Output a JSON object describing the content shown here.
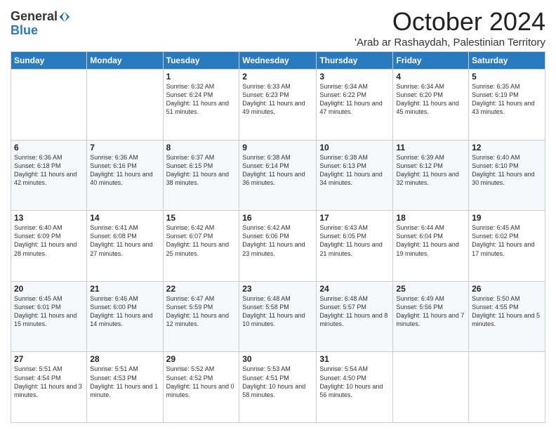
{
  "logo": {
    "general": "General",
    "blue": "Blue"
  },
  "header": {
    "month": "October 2024",
    "location": "'Arab ar Rashaydah, Palestinian Territory"
  },
  "days_of_week": [
    "Sunday",
    "Monday",
    "Tuesday",
    "Wednesday",
    "Thursday",
    "Friday",
    "Saturday"
  ],
  "weeks": [
    [
      {
        "day": "",
        "info": ""
      },
      {
        "day": "",
        "info": ""
      },
      {
        "day": "1",
        "info": "Sunrise: 6:32 AM\nSunset: 6:24 PM\nDaylight: 11 hours and 51 minutes."
      },
      {
        "day": "2",
        "info": "Sunrise: 6:33 AM\nSunset: 6:23 PM\nDaylight: 11 hours and 49 minutes."
      },
      {
        "day": "3",
        "info": "Sunrise: 6:34 AM\nSunset: 6:22 PM\nDaylight: 11 hours and 47 minutes."
      },
      {
        "day": "4",
        "info": "Sunrise: 6:34 AM\nSunset: 6:20 PM\nDaylight: 11 hours and 45 minutes."
      },
      {
        "day": "5",
        "info": "Sunrise: 6:35 AM\nSunset: 6:19 PM\nDaylight: 11 hours and 43 minutes."
      }
    ],
    [
      {
        "day": "6",
        "info": "Sunrise: 6:36 AM\nSunset: 6:18 PM\nDaylight: 11 hours and 42 minutes."
      },
      {
        "day": "7",
        "info": "Sunrise: 6:36 AM\nSunset: 6:16 PM\nDaylight: 11 hours and 40 minutes."
      },
      {
        "day": "8",
        "info": "Sunrise: 6:37 AM\nSunset: 6:15 PM\nDaylight: 11 hours and 38 minutes."
      },
      {
        "day": "9",
        "info": "Sunrise: 6:38 AM\nSunset: 6:14 PM\nDaylight: 11 hours and 36 minutes."
      },
      {
        "day": "10",
        "info": "Sunrise: 6:38 AM\nSunset: 6:13 PM\nDaylight: 11 hours and 34 minutes."
      },
      {
        "day": "11",
        "info": "Sunrise: 6:39 AM\nSunset: 6:12 PM\nDaylight: 11 hours and 32 minutes."
      },
      {
        "day": "12",
        "info": "Sunrise: 6:40 AM\nSunset: 6:10 PM\nDaylight: 11 hours and 30 minutes."
      }
    ],
    [
      {
        "day": "13",
        "info": "Sunrise: 6:40 AM\nSunset: 6:09 PM\nDaylight: 11 hours and 28 minutes."
      },
      {
        "day": "14",
        "info": "Sunrise: 6:41 AM\nSunset: 6:08 PM\nDaylight: 11 hours and 27 minutes."
      },
      {
        "day": "15",
        "info": "Sunrise: 6:42 AM\nSunset: 6:07 PM\nDaylight: 11 hours and 25 minutes."
      },
      {
        "day": "16",
        "info": "Sunrise: 6:42 AM\nSunset: 6:06 PM\nDaylight: 11 hours and 23 minutes."
      },
      {
        "day": "17",
        "info": "Sunrise: 6:43 AM\nSunset: 6:05 PM\nDaylight: 11 hours and 21 minutes."
      },
      {
        "day": "18",
        "info": "Sunrise: 6:44 AM\nSunset: 6:04 PM\nDaylight: 11 hours and 19 minutes."
      },
      {
        "day": "19",
        "info": "Sunrise: 6:45 AM\nSunset: 6:02 PM\nDaylight: 11 hours and 17 minutes."
      }
    ],
    [
      {
        "day": "20",
        "info": "Sunrise: 6:45 AM\nSunset: 6:01 PM\nDaylight: 11 hours and 15 minutes."
      },
      {
        "day": "21",
        "info": "Sunrise: 6:46 AM\nSunset: 6:00 PM\nDaylight: 11 hours and 14 minutes."
      },
      {
        "day": "22",
        "info": "Sunrise: 6:47 AM\nSunset: 5:59 PM\nDaylight: 11 hours and 12 minutes."
      },
      {
        "day": "23",
        "info": "Sunrise: 6:48 AM\nSunset: 5:58 PM\nDaylight: 11 hours and 10 minutes."
      },
      {
        "day": "24",
        "info": "Sunrise: 6:48 AM\nSunset: 5:57 PM\nDaylight: 11 hours and 8 minutes."
      },
      {
        "day": "25",
        "info": "Sunrise: 6:49 AM\nSunset: 5:56 PM\nDaylight: 11 hours and 7 minutes."
      },
      {
        "day": "26",
        "info": "Sunrise: 5:50 AM\nSunset: 4:55 PM\nDaylight: 11 hours and 5 minutes."
      }
    ],
    [
      {
        "day": "27",
        "info": "Sunrise: 5:51 AM\nSunset: 4:54 PM\nDaylight: 11 hours and 3 minutes."
      },
      {
        "day": "28",
        "info": "Sunrise: 5:51 AM\nSunset: 4:53 PM\nDaylight: 11 hours and 1 minute."
      },
      {
        "day": "29",
        "info": "Sunrise: 5:52 AM\nSunset: 4:52 PM\nDaylight: 11 hours and 0 minutes."
      },
      {
        "day": "30",
        "info": "Sunrise: 5:53 AM\nSunset: 4:51 PM\nDaylight: 10 hours and 58 minutes."
      },
      {
        "day": "31",
        "info": "Sunrise: 5:54 AM\nSunset: 4:50 PM\nDaylight: 10 hours and 56 minutes."
      },
      {
        "day": "",
        "info": ""
      },
      {
        "day": "",
        "info": ""
      }
    ]
  ]
}
